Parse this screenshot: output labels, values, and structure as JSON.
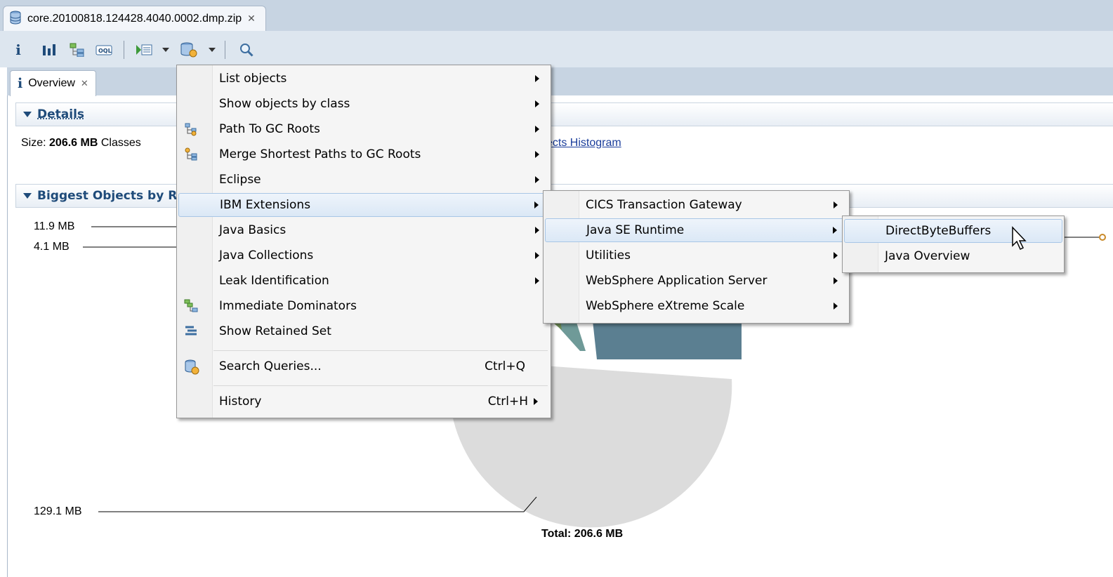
{
  "window": {
    "editor_tab_title": "core.20100818.124428.4040.0002.dmp.zip"
  },
  "toolbar": {
    "items": [
      "info-icon",
      "histogram-icon",
      "dominator-tree-icon",
      "oql-icon",
      "run-report-icon",
      "query-browser-icon",
      "search-icon"
    ]
  },
  "overview_tab": {
    "label": "Overview"
  },
  "details": {
    "heading": "Details",
    "size_label": "Size:",
    "size_value": "206.6 MB",
    "classes_label": "Classes",
    "histogram_link": "ects Histogram"
  },
  "biggest": {
    "heading": "Biggest Objects by R",
    "labels": [
      "11.9 MB",
      "4.1 MB",
      "129.1 MB"
    ],
    "total": "Total: 206.6 MB"
  },
  "menu": {
    "items": [
      {
        "label": "List objects"
      },
      {
        "label": "Show objects by class"
      },
      {
        "label": "Path To GC Roots"
      },
      {
        "label": "Merge Shortest Paths to GC Roots"
      },
      {
        "label": "Eclipse"
      },
      {
        "label": "IBM Extensions"
      },
      {
        "label": "Java Basics"
      },
      {
        "label": "Java Collections"
      },
      {
        "label": "Leak Identification"
      },
      {
        "label": "Immediate Dominators"
      },
      {
        "label": "Show Retained Set"
      },
      {
        "label": "Search Queries...",
        "shortcut": "Ctrl+Q"
      },
      {
        "label": "History",
        "shortcut": "Ctrl+H"
      }
    ]
  },
  "submenu_ibm": {
    "items": [
      {
        "label": "CICS Transaction Gateway"
      },
      {
        "label": "Java SE Runtime"
      },
      {
        "label": "Utilities"
      },
      {
        "label": "WebSphere Application Server"
      },
      {
        "label": "WebSphere eXtreme Scale"
      }
    ]
  },
  "submenu_java_se": {
    "items": [
      {
        "label": "DirectByteBuffers"
      },
      {
        "label": "Java Overview"
      }
    ]
  },
  "colors": {
    "pie_main": "#dcdcdc",
    "pie_dark": "#5b7f91",
    "pie_teal": "#6f9a98",
    "accent": "#1f4b7a"
  }
}
